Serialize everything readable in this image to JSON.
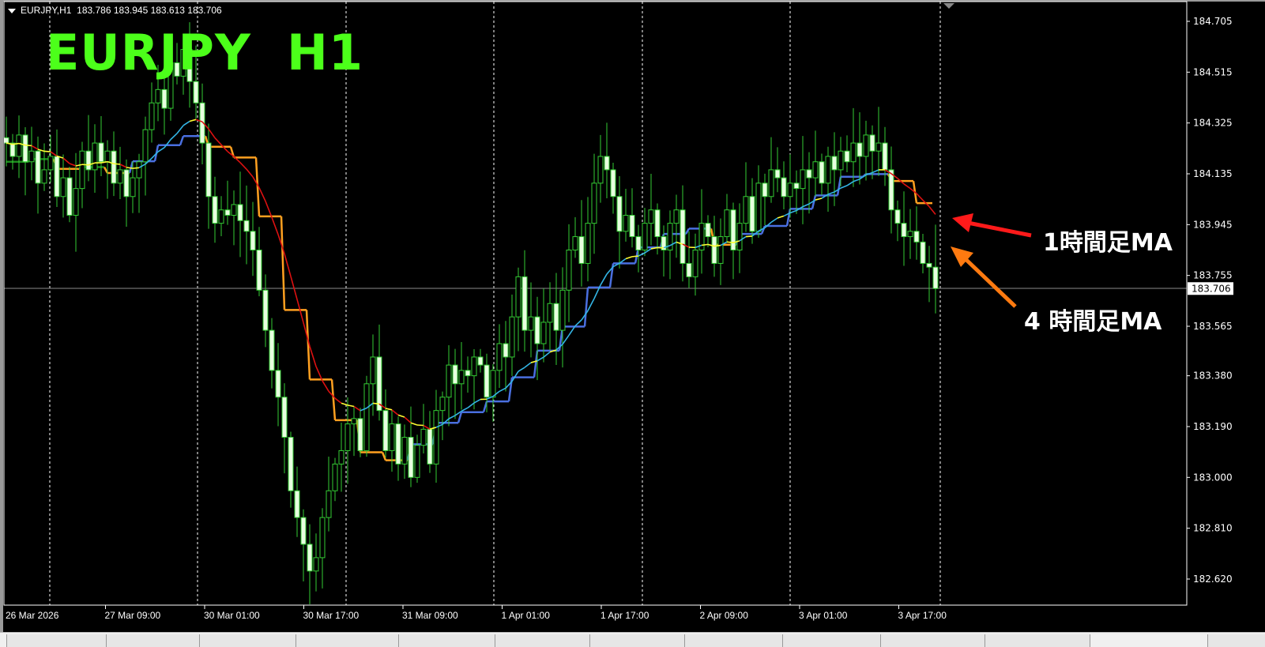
{
  "header": {
    "symbol": "EURJPY,H1",
    "ohlc": "183.786 183.945 183.613 183.706"
  },
  "title_overlay": "EURJPY  H1",
  "annotations": {
    "ma_1h": "1時間足MA",
    "ma_4h": "4 時間足MA",
    "ma_1h_arrow_color": "#ff1a1a",
    "ma_4h_arrow_color": "#ff7a10"
  },
  "colors": {
    "background": "#000000",
    "candle": "#33cc33",
    "bear_body": "#e8ffe0",
    "bull_body": "#000000",
    "ma1h_up": "#33b5e5",
    "ma1h_down": "#dd1111",
    "ma1h_flat": "#ffff33",
    "ma4h_down": "#ffa020",
    "ma4h_up": "#4a6fe0",
    "ma4h_flat": "#1e8a1e",
    "title": "#4cff1a"
  },
  "chart_data": {
    "type": "candlestick",
    "symbol": "EURJPY",
    "timeframe": "H1",
    "ylim": [
      182.54,
      184.78
    ],
    "current_price": "183.706",
    "last_candle": {
      "open": 183.786,
      "high": 183.945,
      "low": 183.613,
      "close": 183.706
    },
    "y_ticks": [
      "184.705",
      "184.515",
      "184.325",
      "184.135",
      "183.945",
      "183.755",
      "183.565",
      "183.380",
      "183.190",
      "183.000",
      "182.810",
      "182.620"
    ],
    "x_ticks": [
      "26 Mar 2026",
      "27 Mar 09:00",
      "30 Mar 01:00",
      "30 Mar 17:00",
      "31 Mar 09:00",
      "1 Apr 01:00",
      "1 Apr 17:00",
      "2 Apr 09:00",
      "3 Apr 01:00",
      "3 Apr 17:00"
    ],
    "closes": [
      184.25,
      184.2,
      184.28,
      184.18,
      184.22,
      184.1,
      184.15,
      184.2,
      184.05,
      184.12,
      183.98,
      184.08,
      184.22,
      184.15,
      184.25,
      184.18,
      184.22,
      184.1,
      184.15,
      184.05,
      184.12,
      184.18,
      184.3,
      184.4,
      184.45,
      184.38,
      184.55,
      184.5,
      184.6,
      184.48,
      184.4,
      184.25,
      184.05,
      183.95,
      184.0,
      183.98,
      184.02,
      183.96,
      183.92,
      183.85,
      183.7,
      183.55,
      183.4,
      183.3,
      183.15,
      182.95,
      182.85,
      182.75,
      182.65,
      182.7,
      182.85,
      182.95,
      183.05,
      183.1,
      183.2,
      183.22,
      183.1,
      183.35,
      183.45,
      183.25,
      183.1,
      183.2,
      183.05,
      183.15,
      183.0,
      183.12,
      183.18,
      183.05,
      183.25,
      183.3,
      183.42,
      183.35,
      183.4,
      183.38,
      183.45,
      183.42,
      183.3,
      183.4,
      183.5,
      183.45,
      183.6,
      183.75,
      183.55,
      183.6,
      183.5,
      183.58,
      183.65,
      183.55,
      183.7,
      183.85,
      183.9,
      183.8,
      183.95,
      184.1,
      184.2,
      184.15,
      184.05,
      183.92,
      183.98,
      183.9,
      183.85,
      183.95,
      184.0,
      183.9,
      183.85,
      183.95,
      184.0,
      183.8,
      183.75,
      183.85,
      183.95,
      183.9,
      183.8,
      183.9,
      184.0,
      183.85,
      183.95,
      184.05,
      183.92,
      184.1,
      184.05,
      184.15,
      184.12,
      184.05,
      184.1,
      184.08,
      184.15,
      184.12,
      184.18,
      184.1,
      184.2,
      184.15,
      184.22,
      184.18,
      184.25,
      184.2,
      184.28,
      184.22,
      184.25,
      184.15,
      184.0,
      183.95,
      183.9,
      183.92,
      183.88,
      183.8,
      183.786,
      183.706
    ],
    "first_open": 184.27,
    "ma_1h": {
      "label": "1時間足MA",
      "type": "EMA",
      "period": 20
    },
    "ma_4h": {
      "label": "4 時間足MA",
      "type": "SMA on H4",
      "period": 5
    },
    "grid": "period-separators"
  }
}
